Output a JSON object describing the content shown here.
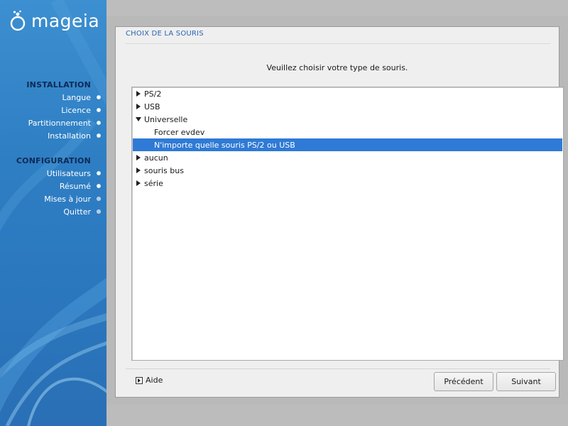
{
  "sidebar": {
    "logo_text": "mageia",
    "sections": [
      {
        "title": "INSTALLATION",
        "items": [
          {
            "label": "Langue",
            "state": "done"
          },
          {
            "label": "Licence",
            "state": "done"
          },
          {
            "label": "Partitionnement",
            "state": "done"
          },
          {
            "label": "Installation",
            "state": "done"
          }
        ]
      },
      {
        "title": "CONFIGURATION",
        "items": [
          {
            "label": "Utilisateurs",
            "state": "done"
          },
          {
            "label": "Résumé",
            "state": "current"
          },
          {
            "label": "Mises à jour",
            "state": "pending"
          },
          {
            "label": "Quitter",
            "state": "pending"
          }
        ]
      }
    ]
  },
  "dialog": {
    "title": "CHOIX DE LA SOURIS",
    "prompt": "Veuillez choisir votre type de souris.",
    "tree": [
      {
        "label": "PS/2",
        "expanded": false
      },
      {
        "label": "USB",
        "expanded": false
      },
      {
        "label": "Universelle",
        "expanded": true
      },
      {
        "label": "Forcer evdev",
        "child": true
      },
      {
        "label": "N'importe quelle souris PS/2 ou USB",
        "child": true,
        "selected": true
      },
      {
        "label": "aucun",
        "expanded": false
      },
      {
        "label": "souris bus",
        "expanded": false
      },
      {
        "label": "série",
        "expanded": false
      }
    ],
    "help_label": "Aide",
    "previous_label": "Précédent",
    "next_label": "Suivant"
  },
  "colors": {
    "sidebar_blue": "#2f7fc4",
    "section_title": "#0d2a55",
    "selection": "#2f7ad6",
    "dialog_title": "#2a63b8"
  }
}
